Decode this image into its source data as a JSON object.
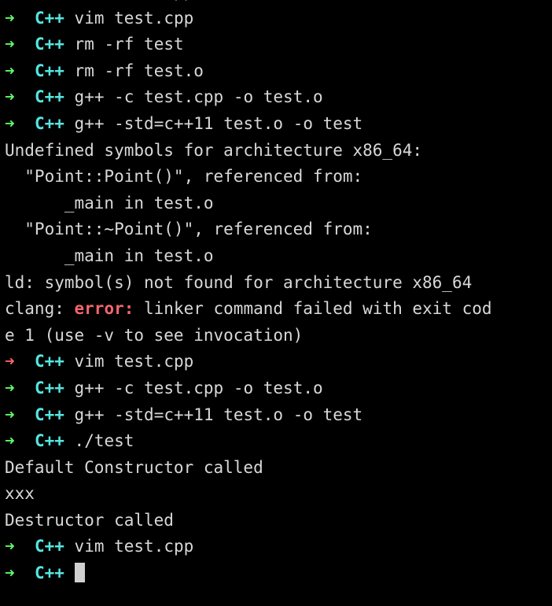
{
  "terminal": {
    "background_color": "#000000",
    "foreground_color": "#d8d8d8",
    "prompt_arrow_color": "#5ff967",
    "prompt_arrow_fail_color": "#f2666b",
    "prompt_cwd_color": "#55e6e0",
    "error_keyword_color": "#f2666b",
    "cursor_color": "#d0d0d0",
    "font_size_px": 21,
    "columns": 50,
    "prompt_arrow_glyph": "➜",
    "prompt_cwd": "C++",
    "cursor_glyph": "block-cursor"
  },
  "lines": [
    {
      "id": "line-01",
      "type": "prompt",
      "status": "ok",
      "arrow": "➜",
      "cwd": "C++",
      "command": "vim test.cpp"
    },
    {
      "id": "line-02",
      "type": "prompt",
      "status": "ok",
      "arrow": "➜",
      "cwd": "C++",
      "command": "rm -rf test"
    },
    {
      "id": "line-03",
      "type": "prompt",
      "status": "ok",
      "arrow": "➜",
      "cwd": "C++",
      "command": "rm -rf test.o"
    },
    {
      "id": "line-04",
      "type": "prompt",
      "status": "ok",
      "arrow": "➜",
      "cwd": "C++",
      "command": "g++ -c test.cpp -o test.o"
    },
    {
      "id": "line-05",
      "type": "prompt",
      "status": "ok",
      "arrow": "➜",
      "cwd": "C++",
      "command": "g++ -std=c++11 test.o -o test"
    },
    {
      "id": "line-06",
      "type": "output",
      "text": "Undefined symbols for architecture x86_64:"
    },
    {
      "id": "line-07",
      "type": "output",
      "text": "  \"Point::Point()\", referenced from:"
    },
    {
      "id": "line-08",
      "type": "output",
      "text": "      _main in test.o"
    },
    {
      "id": "line-09",
      "type": "output",
      "text": "  \"Point::~Point()\", referenced from:"
    },
    {
      "id": "line-10",
      "type": "output",
      "text": "      _main in test.o"
    },
    {
      "id": "line-11",
      "type": "output",
      "text": "ld: symbol(s) not found for architecture x86_64"
    },
    {
      "id": "line-12",
      "type": "output-error",
      "prefix": "clang: ",
      "keyword": "error:",
      "suffix": " linker command failed with exit cod"
    },
    {
      "id": "line-13",
      "type": "output",
      "text": "e 1 (use -v to see invocation)"
    },
    {
      "id": "line-14",
      "type": "prompt",
      "status": "fail",
      "arrow": "➜",
      "cwd": "C++",
      "command": "vim test.cpp"
    },
    {
      "id": "line-15",
      "type": "prompt",
      "status": "ok",
      "arrow": "➜",
      "cwd": "C++",
      "command": "g++ -c test.cpp -o test.o"
    },
    {
      "id": "line-16",
      "type": "prompt",
      "status": "ok",
      "arrow": "➜",
      "cwd": "C++",
      "command": "g++ -std=c++11 test.o -o test"
    },
    {
      "id": "line-17",
      "type": "prompt",
      "status": "ok",
      "arrow": "➜",
      "cwd": "C++",
      "command": "./test"
    },
    {
      "id": "line-18",
      "type": "output",
      "text": "Default Constructor called"
    },
    {
      "id": "line-19",
      "type": "output",
      "text": "xxx"
    },
    {
      "id": "line-20",
      "type": "output",
      "text": "Destructor called"
    },
    {
      "id": "line-21",
      "type": "prompt",
      "status": "ok",
      "arrow": "➜",
      "cwd": "C++",
      "command": "vim test.cpp"
    },
    {
      "id": "line-22",
      "type": "prompt-cursor",
      "status": "ok",
      "arrow": "➜",
      "cwd": "C++",
      "command": ""
    }
  ]
}
